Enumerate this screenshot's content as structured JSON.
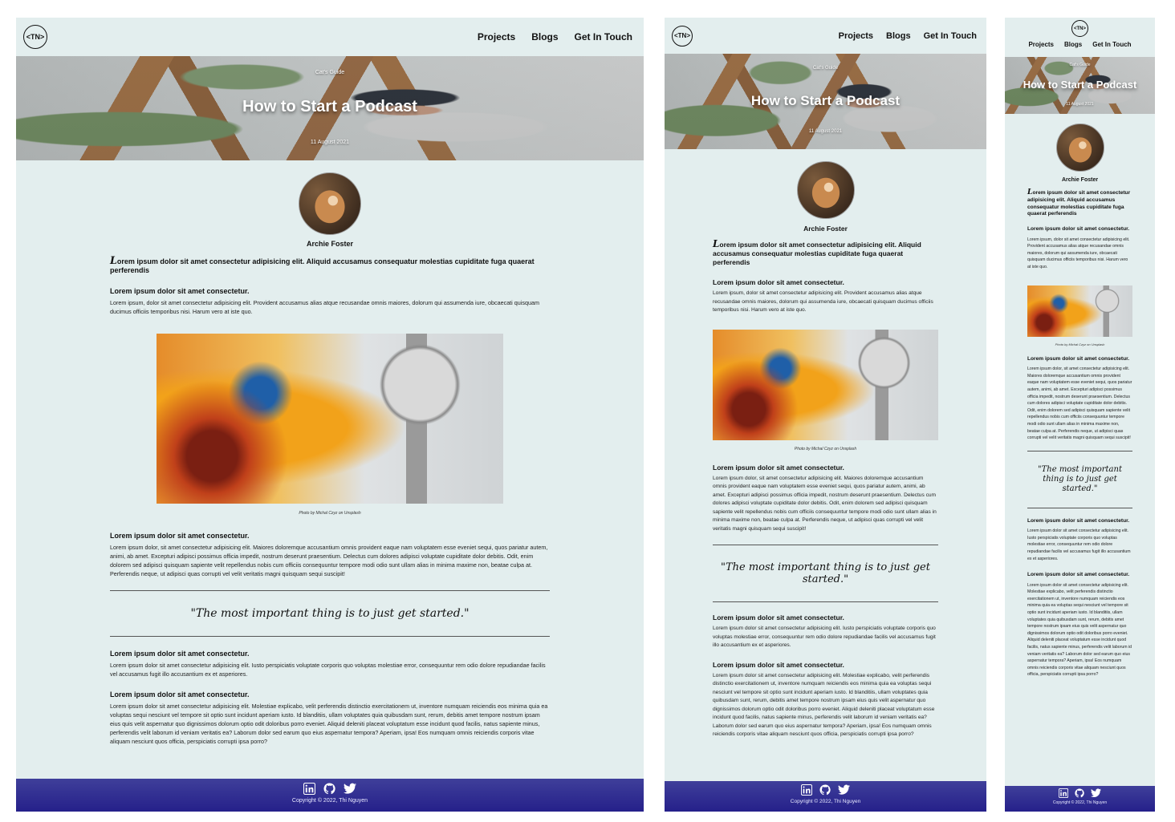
{
  "logo": {
    "text": "<TN>"
  },
  "nav": {
    "projects": "Projects",
    "blogs": "Blogs",
    "contact": "Get In Touch"
  },
  "hero": {
    "category": "Cat's Guide",
    "title": "How to Start a Podcast",
    "date": "11 August 2021"
  },
  "author": {
    "name": "Archie Foster"
  },
  "article": {
    "lead": "Lorem ipsum dolor sit amet consectetur adipisicing elit. Aliquid accusamus consequatur molestias cupiditate fuga quaerat perferendis",
    "s1_heading": "Lorem ipsum dolor sit amet consectetur.",
    "s1_body": "Lorem ipsum, dolor sit amet consectetur adipisicing elit. Provident accusamus alias atque recusandae omnis maiores, dolorum qui assumenda iure, obcaecati quisquam ducimus officiis temporibus nisi. Harum vero at iste quo.",
    "photo_caption": "Photo by Michal Czyz on Unsplash",
    "s2_heading": "Lorem ipsum dolor sit amet consectetur.",
    "s2_body": "Lorem ipsum dolor, sit amet consectetur adipisicing elit. Maiores doloremque accusantium omnis provident eaque nam voluptatem esse eveniet sequi, quos pariatur autem, animi, ab amet. Excepturi adipisci possimus officia impedit, nostrum deserunt praesentium. Delectus cum dolores adipisci voluptate cupiditate dolor debitis. Odit, enim dolorem sed adipisci quisquam sapiente velit repellendus nobis cum officiis consequuntur tempore modi odio sunt ullam alias in minima maxime non, beatae culpa at. Perferendis neque, ut adipisci quas corrupti vel velit veritatis magni quisquam sequi suscipit!",
    "quote": "\"The most important thing is to just get started.\"",
    "s3_heading": "Lorem ipsum dolor sit amet consectetur.",
    "s3_body": "Lorem ipsum dolor sit amet consectetur adipisicing elit. Iusto perspiciatis voluptate corporis quo voluptas molestiae error, consequuntur rem odio dolore repudiandae facilis vel accusamus fugit illo accusantium ex et asperiores.",
    "s4_heading": "Lorem ipsum dolor sit amet consectetur.",
    "s4_body": "Lorem ipsum dolor sit amet consectetur adipisicing elit. Molestiae explicabo, velit perferendis distinctio exercitationem ut, inventore numquam reiciendis eos minima quia ea voluptas sequi nesciunt vel tempore sit optio sunt incidunt aperiam iusto. Id blanditiis, ullam voluptates quia quibusdam sunt, rerum, debitis amet tempore nostrum ipsam eius quis velit aspernatur quo dignissimos dolorum optio odit doloribus porro eveniet. Aliquid deleniti placeat voluptatum esse incidunt quod facilis, natus sapiente minus, perferendis velit laborum id veniam veritatis ea? Laborum dolor sed earum quo eius aspernatur tempora? Aperiam, ipsa! Eos numquam omnis reiciendis corporis vitae aliquam nesciunt quos officia, perspiciatis corrupti ipsa porro?"
  },
  "footer": {
    "icons": [
      "linkedin-icon",
      "github-icon",
      "twitter-icon"
    ],
    "copyright": "Copyright © 2022, Thi Nguyen"
  },
  "colors": {
    "page_bg": "#e3eeee",
    "footer_top": "#3f3f9a",
    "footer_bottom": "#25208a"
  }
}
